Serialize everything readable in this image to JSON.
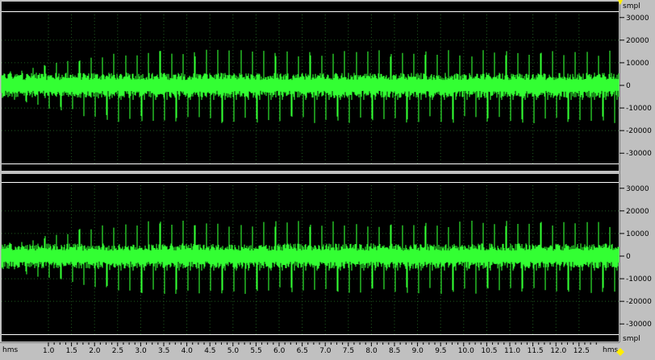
{
  "colors": {
    "background": "#000000",
    "waveform": "#33ff33",
    "grid": "#1f5a1f",
    "boundary": "#ffffff",
    "chrome": "#c0c0c0",
    "cursor": "#ffee00"
  },
  "icons": {
    "zoom_handle_top": "yellow-triangle-icon",
    "zoom_handle_bottom": "yellow-diamond-icon"
  },
  "chart_data": {
    "type": "line",
    "waveform_style": "stereo audio sample waveform",
    "x_unit": "hms",
    "y_unit": "smpl",
    "x_ticks": [
      "1.0",
      "1.5",
      "2.0",
      "2.5",
      "3.0",
      "3.5",
      "4.0",
      "4.5",
      "5.0",
      "5.5",
      "6.0",
      "6.5",
      "7.0",
      "7.5",
      "8.0",
      "8.5",
      "9.0",
      "9.5",
      "10.0",
      "10.5",
      "11.0",
      "11.5",
      "12.0",
      "12.5"
    ],
    "y_ticks": [
      {
        "value": 30000,
        "label": "30000"
      },
      {
        "value": 20000,
        "label": "20000"
      },
      {
        "value": 10000,
        "label": "10000"
      },
      {
        "value": 0,
        "label": "0"
      },
      {
        "value": -10000,
        "label": "-10000"
      },
      {
        "value": -20000,
        "label": "-20000"
      },
      {
        "value": -30000,
        "label": "-30000"
      }
    ],
    "ylim": [
      -32768,
      32767
    ],
    "channels": [
      {
        "name": "",
        "baseline": 0,
        "spike_max": 15000,
        "spike_min": -16000,
        "noise_level": 4000
      },
      {
        "name": "",
        "baseline": 0,
        "spike_max": 15000,
        "spike_min": -16000,
        "noise_level": 4000
      }
    ]
  }
}
